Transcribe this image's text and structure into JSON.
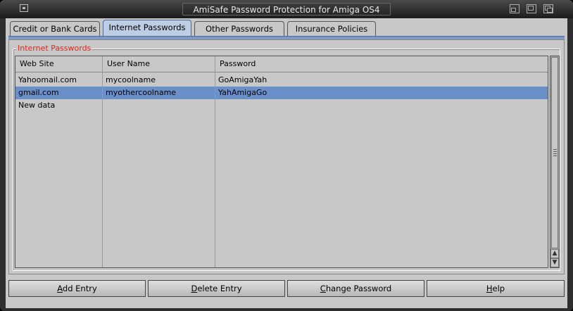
{
  "window": {
    "title": "AmiSafe Password Protection for Amiga OS4"
  },
  "tabs": [
    {
      "label": "Credit or Bank Cards",
      "active": false
    },
    {
      "label": "Internet Passwords",
      "active": true
    },
    {
      "label": "Other Passwords",
      "active": false
    },
    {
      "label": "Insurance Policies",
      "active": false
    }
  ],
  "group": {
    "label": "Internet Passwords"
  },
  "table": {
    "columns": [
      "Web Site",
      "User Name",
      "Password"
    ],
    "rows": [
      {
        "site": "Yahoomail.com",
        "user": "mycoolname",
        "password": "GoAmigaYah",
        "selected": false
      },
      {
        "site": "gmail.com",
        "user": "myothercoolname",
        "password": "YahAmigaGo",
        "selected": true
      },
      {
        "site": "New data",
        "user": "",
        "password": "",
        "selected": false
      }
    ]
  },
  "buttons": {
    "add": {
      "key": "A",
      "rest": "dd Entry"
    },
    "delete": {
      "key": "D",
      "rest": "elete Entry"
    },
    "change": {
      "key": "C",
      "rest": "hange Password"
    },
    "help": {
      "key": "H",
      "rest": "elp"
    }
  },
  "colors": {
    "accent": "#6a8fc9",
    "group_label": "#e0261d",
    "tab_active": "#bccde4"
  },
  "icons": [
    "close-icon",
    "iconify-icon",
    "zoom-icon",
    "depth-icon",
    "arrow-up-icon",
    "arrow-down-icon"
  ]
}
